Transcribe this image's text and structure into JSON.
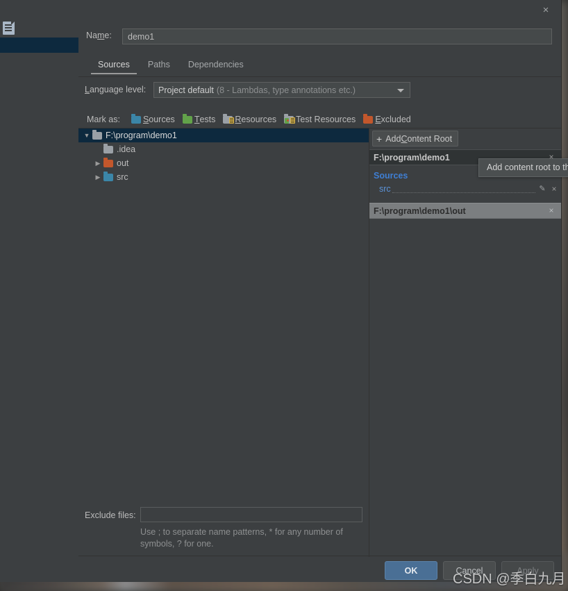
{
  "window": {
    "close_label": "×"
  },
  "ide": {
    "module_icon": "module-icon"
  },
  "name_field": {
    "label_pre": "Na",
    "label_mnemonic": "m",
    "label_post": "e:",
    "value": "demo1",
    "placeholder": ""
  },
  "tabs": [
    {
      "label": "Sources",
      "active": true
    },
    {
      "label": "Paths",
      "active": false
    },
    {
      "label": "Dependencies",
      "active": false
    }
  ],
  "language_level": {
    "label_mnemonic": "L",
    "label_rest": "anguage level:",
    "value": "Project default",
    "hint": "(8 - Lambdas, type annotations etc.)"
  },
  "mark_as": {
    "label": "Mark as:",
    "items": [
      {
        "mnemonic": "S",
        "rest": "ources",
        "color": "#3b86a8",
        "kind": "plain"
      },
      {
        "mnemonic": "T",
        "rest": "ests",
        "color": "#62a24a",
        "kind": "plain"
      },
      {
        "mnemonic": "R",
        "rest": "esources",
        "color": "#9aa0a6",
        "kind": "resources"
      },
      {
        "mnemonic": "",
        "rest": "Test Resources",
        "color": "#9aa0a6",
        "kind": "test-resources"
      },
      {
        "mnemonic": "E",
        "rest": "xcluded",
        "color": "#c2572c",
        "kind": "plain"
      }
    ]
  },
  "tree": {
    "rows": [
      {
        "label": "F:\\program\\demo1",
        "twisty": "▼",
        "depth": 0,
        "color": "grey",
        "selected": true
      },
      {
        "label": ".idea",
        "twisty": "",
        "depth": 1,
        "color": "grey",
        "selected": false
      },
      {
        "label": "out",
        "twisty": "▶",
        "depth": 1,
        "color": "orange",
        "selected": false
      },
      {
        "label": "src",
        "twisty": "▶",
        "depth": 1,
        "color": "blue",
        "selected": false
      }
    ]
  },
  "content_roots": {
    "add_button": {
      "plus": "+",
      "pre": "Add ",
      "mnemonic": "C",
      "post": "ontent Root"
    },
    "groups": [
      {
        "path": "F:\\program\\demo1",
        "style": "dark",
        "close_label": "×",
        "section_title": "Sources",
        "entries": [
          {
            "name": "src",
            "edit_label": "✎",
            "close_label": "×"
          }
        ]
      },
      {
        "path": "F:\\program\\demo1\\out",
        "style": "grey",
        "close_label": "×",
        "section_title": "",
        "entries": []
      }
    ]
  },
  "tooltip": {
    "text": "Add content root to the module"
  },
  "exclude": {
    "label": "Exclude files:",
    "value": "",
    "placeholder": "",
    "hint": "Use ; to separate name patterns, * for any number of symbols, ? for one."
  },
  "buttons": {
    "ok": "OK",
    "cancel": "Cancel",
    "apply": "Apply"
  },
  "watermark": {
    "text": "CSDN @季白九月"
  },
  "colors": {
    "accent_blue": "#4a6f95",
    "selection_blue": "#0d293e",
    "link_blue": "#3f7fd4",
    "panel_bg": "#3c3f41"
  }
}
